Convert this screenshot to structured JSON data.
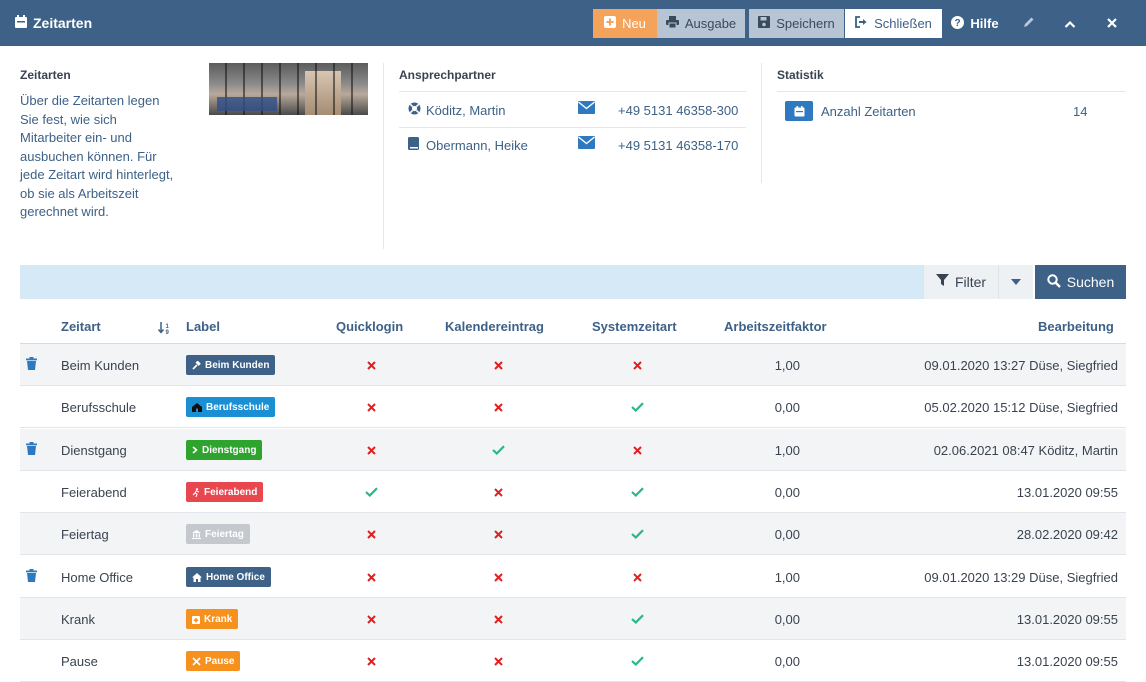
{
  "window": {
    "title": "Zeitarten",
    "title_icon": "calendar-icon",
    "buttons": {
      "neu": "Neu",
      "ausgabe": "Ausgabe",
      "speichern": "Speichern",
      "schliessen": "Schließen",
      "hilfe": "Hilfe"
    }
  },
  "info": {
    "title": "Zeitarten",
    "text": "Über die Zeitarten legen Sie fest, wie sich Mitarbeiter ein- und ausbuchen können. Für jede Zeitart wird hinterlegt, ob sie als Arbeitszeit gerechnet wird."
  },
  "contacts": {
    "title": "Ansprechpartner",
    "items": [
      {
        "name": "Köditz, Martin",
        "icon": "lifebuoy-icon",
        "phone": "+49 5131 46358-300"
      },
      {
        "name": "Obermann, Heike",
        "icon": "book-icon",
        "phone": "+49 5131 46358-170"
      }
    ]
  },
  "stats": {
    "title": "Statistik",
    "label": "Anzahl Zeitarten",
    "value": "14"
  },
  "search": {
    "filter_label": "Filter",
    "search_label": "Suchen"
  },
  "table": {
    "columns": {
      "zeitart": "Zeitart",
      "label": "Label",
      "quicklogin": "Quicklogin",
      "kalender": "Kalendereintrag",
      "system": "Systemzeitart",
      "faktor": "Arbeitszeitfaktor",
      "bearbeitung": "Bearbeitung"
    },
    "rows": [
      {
        "name": "Beim Kunden",
        "label": "Beim Kunden",
        "label_color": "#3d6187",
        "label_icon": "hammer-icon",
        "deletable": true,
        "quicklogin": false,
        "kalender": false,
        "system": false,
        "faktor": "1,00",
        "bearbeitung": "09.01.2020 13:27 Düse, Siegfried"
      },
      {
        "name": "Berufsschule",
        "label": "Berufsschule",
        "label_color": "#1a8fd3",
        "label_icon": "school-icon",
        "deletable": false,
        "quicklogin": false,
        "kalender": false,
        "system": true,
        "faktor": "0,00",
        "bearbeitung": "05.02.2020 15:12 Düse, Siegfried"
      },
      {
        "name": "Dienstgang",
        "label": "Dienstgang",
        "label_color": "#2ea32e",
        "label_icon": "chevron-right-icon",
        "deletable": true,
        "quicklogin": false,
        "kalender": true,
        "system": false,
        "faktor": "1,00",
        "bearbeitung": "02.06.2021 08:47 Köditz, Martin"
      },
      {
        "name": "Feierabend",
        "label": "Feierabend",
        "label_color": "#e8474f",
        "label_icon": "running-icon",
        "deletable": false,
        "quicklogin": true,
        "kalender": false,
        "system": true,
        "faktor": "0,00",
        "bearbeitung": "13.01.2020 09:55"
      },
      {
        "name": "Feiertag",
        "label": "Feiertag",
        "label_color": "#c5c9ce",
        "label_icon": "building-icon",
        "deletable": false,
        "quicklogin": false,
        "kalender": false,
        "system": true,
        "faktor": "0,00",
        "bearbeitung": "28.02.2020 09:42"
      },
      {
        "name": "Home Office",
        "label": "Home Office",
        "label_color": "#3d6187",
        "label_icon": "home-icon",
        "deletable": true,
        "quicklogin": false,
        "kalender": false,
        "system": false,
        "faktor": "1,00",
        "bearbeitung": "09.01.2020 13:29 Düse, Siegfried"
      },
      {
        "name": "Krank",
        "label": "Krank",
        "label_color": "#f7911e",
        "label_icon": "medkit-icon",
        "deletable": false,
        "quicklogin": false,
        "kalender": false,
        "system": true,
        "faktor": "0,00",
        "bearbeitung": "13.01.2020 09:55"
      },
      {
        "name": "Pause",
        "label": "Pause",
        "label_color": "#f7911e",
        "label_icon": "utensils-icon",
        "deletable": false,
        "quicklogin": false,
        "kalender": false,
        "system": true,
        "faktor": "0,00",
        "bearbeitung": "13.01.2020 09:55"
      }
    ]
  }
}
